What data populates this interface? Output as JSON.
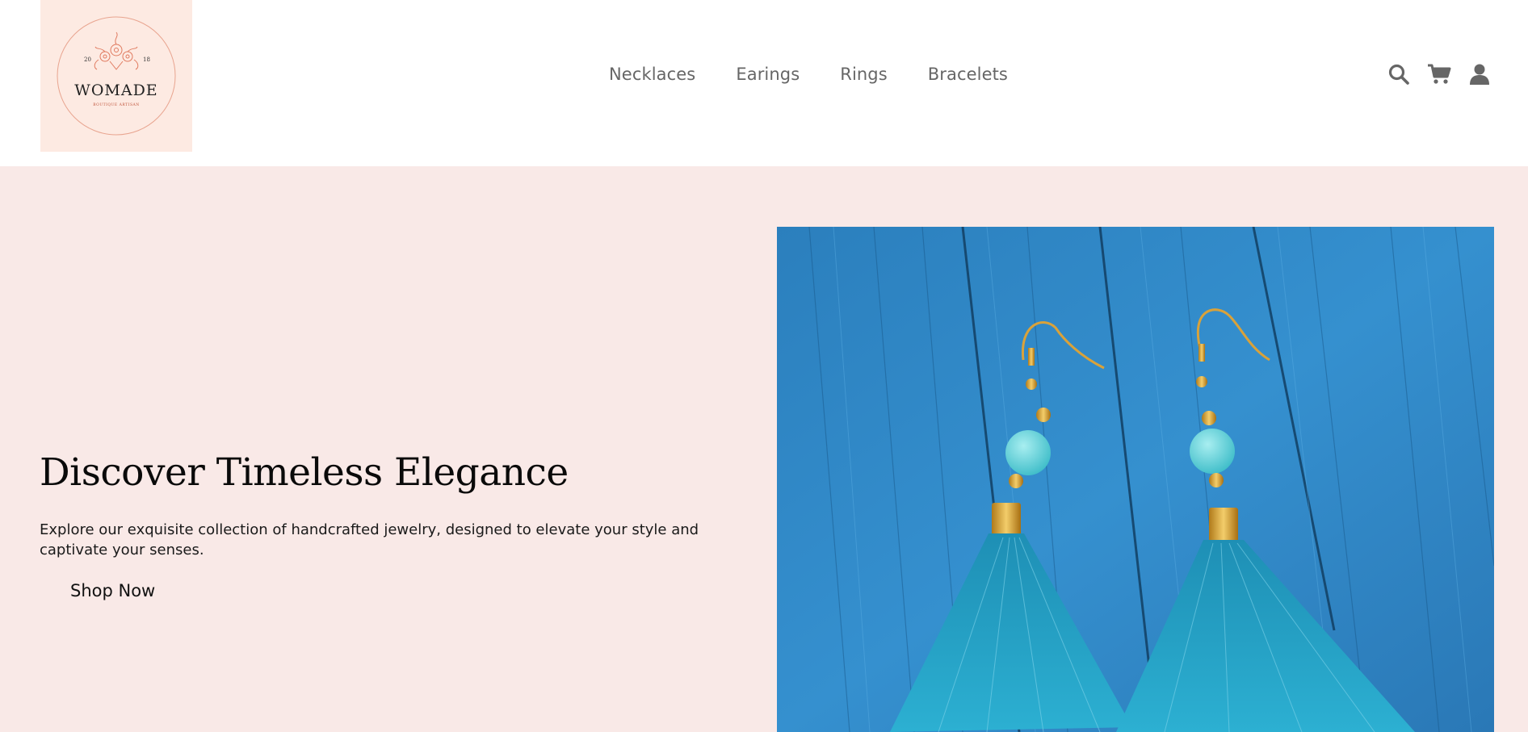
{
  "logo": {
    "year_left": "20",
    "year_right": "18",
    "brand": "WOMADE",
    "tagline": "BOUTIQUE ARTISAN"
  },
  "nav": {
    "items": [
      {
        "label": "Necklaces"
      },
      {
        "label": "Earings"
      },
      {
        "label": "Rings"
      },
      {
        "label": "Bracelets"
      }
    ]
  },
  "header_icons": [
    "search-icon",
    "cart-icon",
    "user-icon"
  ],
  "hero": {
    "title": "Discover Timeless Elegance",
    "description": "Explore our exquisite collection of handcrafted jewelry, designed to elevate your style and captivate your senses.",
    "cta_label": "Shop Now",
    "image_subject": "Turquoise bead tassel earrings on blue wood"
  },
  "colors": {
    "hero_background": "#f9e9e7",
    "logo_background": "#fdeae2",
    "logo_accent": "#e07a5f",
    "nav_text": "#666666",
    "icon_color": "#666666",
    "image_wood": "#2f86c4",
    "tassel": "#2a9ec0"
  }
}
